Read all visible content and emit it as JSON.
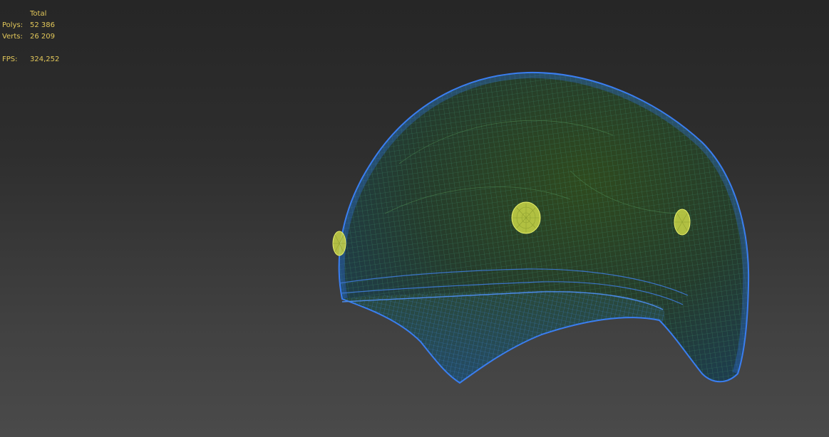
{
  "stats": {
    "header": "Total",
    "rows": [
      {
        "label": "Polys:",
        "value": "52 386"
      },
      {
        "label": "Verts:",
        "value": "26 209"
      }
    ],
    "fps_label": "FPS:",
    "fps_value": "324,252"
  },
  "colors": {
    "wire": "#2f6fe0",
    "wire_inner": "#4f8a54",
    "marker": "#d9e84a",
    "fill_top": "#1f3f3a",
    "fill_mid": "#27412c"
  },
  "scene": {
    "object": "helmet-wireframe",
    "markers": 3
  }
}
